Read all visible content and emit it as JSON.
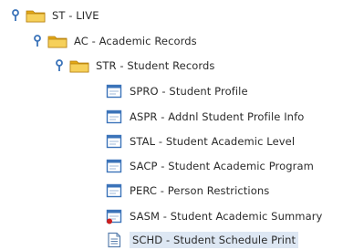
{
  "tree": {
    "root": {
      "label": "ST - LIVE",
      "icon": "folder-icon",
      "toggle_icon": "expanded-pin-icon"
    },
    "level1": {
      "label": "AC - Academic Records",
      "icon": "folder-icon",
      "toggle_icon": "expanded-pin-icon"
    },
    "level2": {
      "label": "STR - Student Records",
      "icon": "folder-icon",
      "toggle_icon": "expanded-pin-icon"
    },
    "forms": [
      {
        "label": "SPRO - Student Profile",
        "icon": "form-window-icon"
      },
      {
        "label": "ASPR - Addnl Student Profile Info",
        "icon": "form-window-icon"
      },
      {
        "label": "STAL - Student Academic Level",
        "icon": "form-window-icon"
      },
      {
        "label": "SACP - Student Academic Program",
        "icon": "form-window-icon"
      },
      {
        "label": "PERC - Person Restrictions",
        "icon": "form-window-icon"
      },
      {
        "label": "SASM - Student Academic Summary",
        "icon": "form-window-flagged-icon"
      },
      {
        "label": "SCHD - Student Schedule Print",
        "icon": "report-page-icon",
        "selected": true
      }
    ]
  },
  "colors": {
    "pin": "#3b73b9",
    "folder": "#f1c232",
    "selected_background": "#dde7f3",
    "flag": "#cc1f1f"
  }
}
